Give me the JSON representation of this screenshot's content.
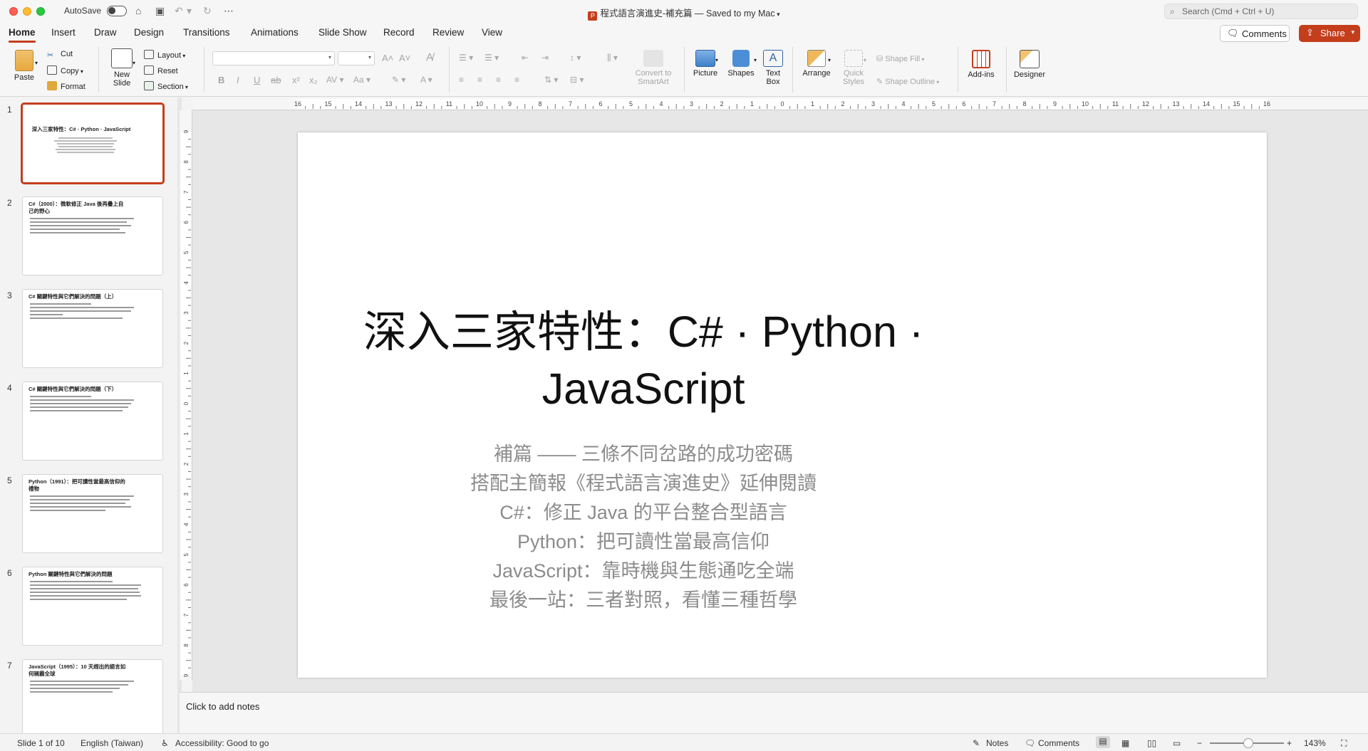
{
  "window": {
    "autosave_label": "AutoSave",
    "doc_title": "程式語言演進史-補充篇 — Saved to my Mac",
    "search_placeholder": "Search (Cmd + Ctrl + U)"
  },
  "tabs": [
    "Home",
    "Insert",
    "Draw",
    "Design",
    "Transitions",
    "Animations",
    "Slide Show",
    "Record",
    "Review",
    "View"
  ],
  "active_tab": "Home",
  "header_buttons": {
    "comments": "Comments",
    "share": "Share"
  },
  "ribbon": {
    "paste": "Paste",
    "cut": "Cut",
    "copy": "Copy",
    "format": "Format",
    "new_slide": "New Slide",
    "layout": "Layout",
    "reset": "Reset",
    "section": "Section",
    "convert_smartart": "Convert to SmartArt",
    "picture": "Picture",
    "shapes": "Shapes",
    "text_box": "Text Box",
    "arrange": "Arrange",
    "quick_styles": "Quick Styles",
    "shape_fill": "Shape Fill",
    "shape_outline": "Shape Outline",
    "add_ins": "Add-ins",
    "designer": "Designer"
  },
  "slides": [
    {
      "num": "1",
      "title": "深入三家特性：C# · Python · JavaScript"
    },
    {
      "num": "2",
      "title": "C#（2000）：微軟修正 Java 後再疊上自己的野心"
    },
    {
      "num": "3",
      "title": "C# 關鍵特性與它們解決的問題（上）"
    },
    {
      "num": "4",
      "title": "C# 關鍵特性與它們解決的問題（下）"
    },
    {
      "num": "5",
      "title": "Python（1991）：把可讀性當最高信仰的禮物"
    },
    {
      "num": "6",
      "title": "Python 關鍵特性與它們解決的問題"
    },
    {
      "num": "7",
      "title": "JavaScript（1995）：10 天趕出的語言如何稱霸全球"
    }
  ],
  "current_slide": {
    "title_line1": "深入三家特性：C# · Python ·",
    "title_line2": "JavaScript",
    "subtitle_lines": [
      "補篇 —— 三條不同岔路的成功密碼",
      "搭配主簡報《程式語言演進史》延伸閱讀",
      "C#：修正 Java 的平台整合型語言",
      "Python：把可讀性當最高信仰",
      "JavaScript：靠時機與生態通吃全端",
      "最後一站：三者對照，看懂三種哲學"
    ]
  },
  "ruler": {
    "h_labels": [
      "16",
      "15",
      "14",
      "13",
      "12",
      "11",
      "10",
      "9",
      "8",
      "7",
      "6",
      "5",
      "4",
      "3",
      "2",
      "1",
      "0",
      "1",
      "2",
      "3",
      "4",
      "5",
      "6",
      "7",
      "8",
      "9",
      "10",
      "11",
      "12",
      "13",
      "14",
      "15",
      "16"
    ],
    "v_labels": [
      "9",
      "8",
      "7",
      "6",
      "5",
      "4",
      "3",
      "2",
      "1",
      "0",
      "1",
      "2",
      "3",
      "4",
      "5",
      "6",
      "7",
      "8",
      "9"
    ]
  },
  "notes_placeholder": "Click to add notes",
  "status": {
    "slide_info": "Slide 1 of 10",
    "language": "English (Taiwan)",
    "accessibility": "Accessibility: Good to go",
    "notes": "Notes",
    "comments": "Comments",
    "zoom": "143%"
  }
}
